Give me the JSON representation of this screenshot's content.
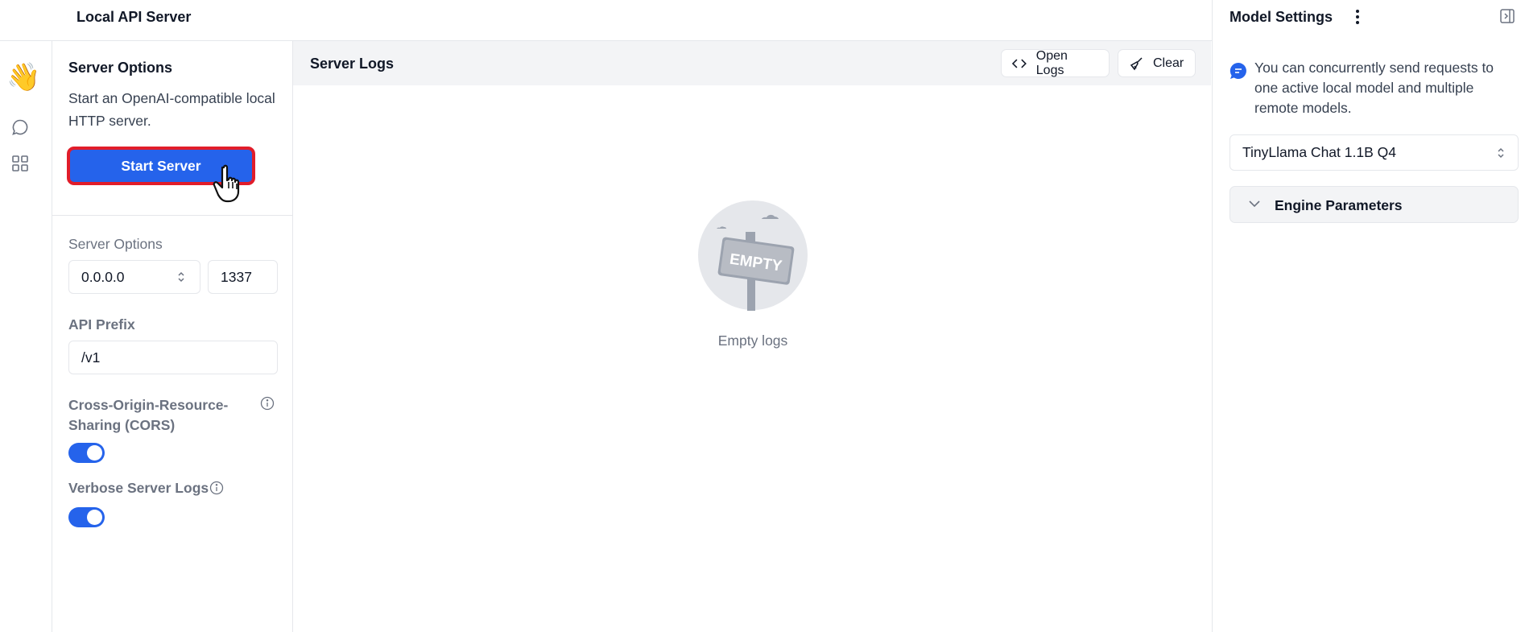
{
  "header": {
    "title": "Local API Server"
  },
  "rail": {
    "items": [
      "waving-hand",
      "chat-icon",
      "grid-icon"
    ]
  },
  "server_options": {
    "title": "Server Options",
    "description": "Start an OpenAI-compatible local HTTP server.",
    "start_button": "Start Server",
    "options_label": "Server Options",
    "host_value": "0.0.0.0",
    "port_value": "1337",
    "api_prefix_label": "API Prefix",
    "api_prefix_value": "/v1",
    "cors_label": "Cross-Origin-Resource-Sharing (CORS)",
    "cors_enabled": true,
    "verbose_label": "Verbose Server Logs",
    "verbose_enabled": true
  },
  "logs": {
    "title": "Server Logs",
    "open_logs_label": "Open Logs",
    "clear_label": "Clear",
    "empty_sign": "EMPTY",
    "empty_text": "Empty logs"
  },
  "model_settings": {
    "title": "Model Settings",
    "notice": "You can concurrently send requests to one active local model and multiple remote models.",
    "selected_model": "TinyLlama Chat 1.1B Q4",
    "engine_parameters_label": "Engine Parameters"
  },
  "colors": {
    "accent": "#2563eb",
    "highlight_border": "#e11d2a"
  }
}
